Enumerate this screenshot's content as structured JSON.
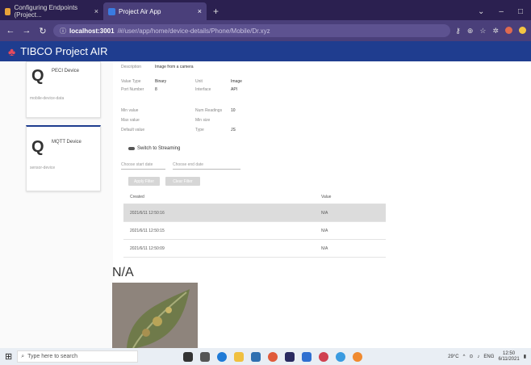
{
  "browser": {
    "tabs": [
      {
        "title": "Configuring Endpoints (Project..."
      },
      {
        "title": "Project Air App"
      }
    ],
    "url_host": "localhost:3001",
    "url_path": "/#/user/app/home/device-details/Phone/Mobile/Dr.xyz"
  },
  "app": {
    "title": "TIBCO Project AIR"
  },
  "devices": [
    {
      "name": "PECI Device",
      "sub": "mobile-device-data"
    },
    {
      "name": "MQTT Device",
      "sub": "sensor-device"
    }
  ],
  "details": {
    "description_label": "Description",
    "description_value": "Image from a camera",
    "value_type_label": "Value Type",
    "value_type_value": "Binary",
    "unit_label": "Unit",
    "unit_value": "Image",
    "port_number_label": "Port Number",
    "port_number_value": "8",
    "interface_label": "Interface",
    "interface_value": "API",
    "min_value_label": "Min value",
    "max_value_label": "Max value",
    "default_value_label": "Default value",
    "num_readings_label": "Num Readings",
    "num_readings_value": "10",
    "min_size_label": "Min size",
    "type_label": "Type",
    "type_value": "JS",
    "switch_label": "Switch to Streaming",
    "field1": "Choose start date",
    "field2": "Choose end date",
    "btn1": "Apply Filter",
    "btn2": "Clear Filter"
  },
  "table": {
    "col1": "Created",
    "col2": "Value",
    "rows": [
      {
        "date": "2021/6/11 12:50:16",
        "value": "N/A"
      },
      {
        "date": "2021/6/11 12:50:15",
        "value": "N/A"
      },
      {
        "date": "2021/6/11 12:50:09",
        "value": "N/A"
      }
    ]
  },
  "preview": {
    "label": "N/A"
  },
  "taskbar": {
    "search": "Type here to search",
    "weather": "29°C",
    "lang": "ENG",
    "time": "12:50",
    "date": "6/11/2021"
  }
}
